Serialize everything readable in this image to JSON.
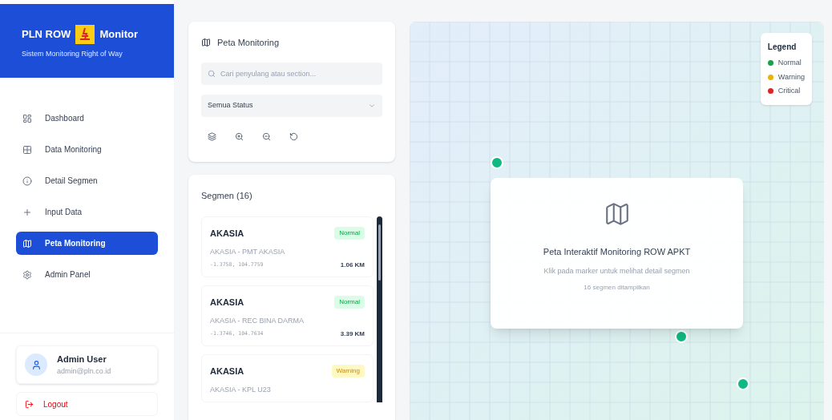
{
  "brand": {
    "title_left": "PLN ROW",
    "title_right": "Monitor",
    "subtitle": "Sistem Monitoring Right of Way"
  },
  "nav": [
    {
      "label": "Dashboard",
      "selected": false
    },
    {
      "label": "Data Monitoring",
      "selected": false
    },
    {
      "label": "Detail Segmen",
      "selected": false
    },
    {
      "label": "Input Data",
      "selected": false
    },
    {
      "label": "Peta Monitoring",
      "selected": true
    },
    {
      "label": "Admin Panel",
      "selected": false
    }
  ],
  "user": {
    "name": "Admin User",
    "email": "admin@pln.co.id"
  },
  "logout": "Logout",
  "controls": {
    "title": "Peta Monitoring",
    "search_placeholder": "Cari penyulang atau section...",
    "status_filter": "Semua Status"
  },
  "segments": {
    "title": "Segmen (16)",
    "items": [
      {
        "name": "AKASIA",
        "status": "Normal",
        "kind": "normal",
        "route": "AKASIA - PMT AKASIA",
        "coords": "-1.3758, 104.7759",
        "length": "1.06 KM"
      },
      {
        "name": "AKASIA",
        "status": "Normal",
        "kind": "normal",
        "route": "AKASIA - REC BINA DARMA",
        "coords": "-1.3746, 104.7634",
        "length": "3.39 KM"
      },
      {
        "name": "AKASIA",
        "status": "Warning",
        "kind": "warning",
        "route": "AKASIA - KPL U23"
      }
    ]
  },
  "legend": {
    "title": "Legend",
    "items": [
      {
        "label": "Normal",
        "color": "#16a34a"
      },
      {
        "label": "Warning",
        "color": "#eab308"
      },
      {
        "label": "Critical",
        "color": "#dc2626"
      }
    ]
  },
  "map_card": {
    "title": "Peta Interaktif Monitoring ROW APKT",
    "hint": "Klik pada marker untuk melihat detail segmen",
    "count": "16 segmen ditampilkan"
  },
  "markers": [
    {
      "color": "#10b981"
    },
    {
      "color": "#10b981"
    },
    {
      "color": "#10b981"
    }
  ]
}
